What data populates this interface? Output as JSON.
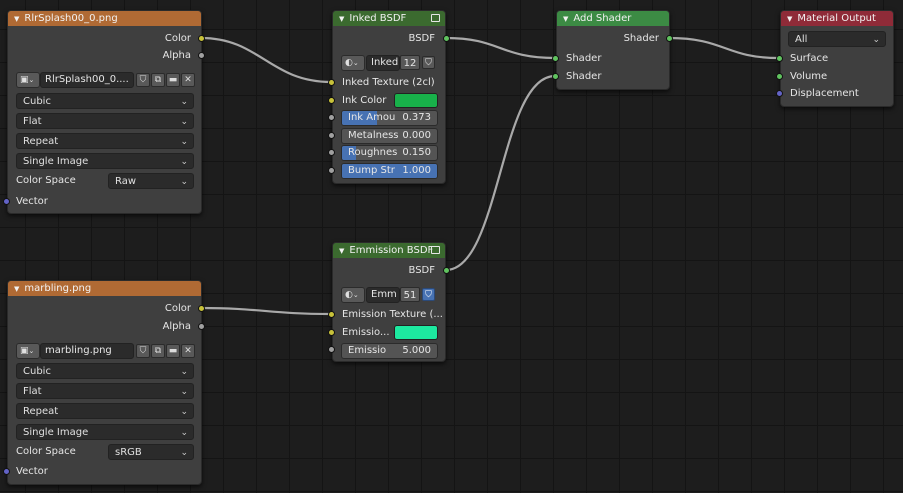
{
  "nodes": {
    "image1": {
      "title": "RlrSplash00_0.png",
      "outputs": [
        "Color",
        "Alpha"
      ],
      "image_name": "RlrSplash00_0....",
      "interpolation": "Cubic",
      "projection": "Flat",
      "extension": "Repeat",
      "source": "Single Image",
      "color_space_label": "Color Space",
      "color_space": "Raw",
      "input": "Vector"
    },
    "image2": {
      "title": "marbling.png",
      "outputs": [
        "Color",
        "Alpha"
      ],
      "image_name": "marbling.png",
      "interpolation": "Cubic",
      "projection": "Flat",
      "extension": "Repeat",
      "source": "Single Image",
      "color_space_label": "Color Space",
      "color_space": "sRGB",
      "input": "Vector"
    },
    "inked": {
      "title": "Inked BSDF",
      "output": "BSDF",
      "group_name": "Inked",
      "users": "12",
      "inputs": {
        "texture": "Inked Texture (2cl)",
        "color_label": "Ink Color",
        "color": "#18b14a",
        "ink_amount_label": "Ink Amou",
        "ink_amount": "0.373",
        "metalness_label": "Metalness",
        "metalness": "0.000",
        "roughness_label": "Roughnes",
        "roughness": "0.150",
        "bump_label": "Bump Str",
        "bump": "1.000"
      }
    },
    "emission": {
      "title": "Emmission BSDF",
      "output": "BSDF",
      "group_name": "Emm",
      "users": "51",
      "inputs": {
        "texture": "Emission Texture (...",
        "color_label": "Emissio...",
        "color": "#1de9a0",
        "strength_label": "Emissio",
        "strength": "5.000"
      }
    },
    "add_shader": {
      "title": "Add Shader",
      "output": "Shader",
      "inputs": [
        "Shader",
        "Shader"
      ]
    },
    "output": {
      "title": "Material Output",
      "target": "All",
      "inputs": [
        "Surface",
        "Volume",
        "Displacement"
      ]
    }
  },
  "colors": {
    "image_header": "#b06a34",
    "shader_header": "#3b6a2f",
    "add_header": "#3c8b44",
    "output_header": "#8f2b38",
    "slider_fill": "#4772b3"
  },
  "icons": {
    "collapse": "triangle-down-icon",
    "image_type": "image-icon",
    "sphere": "material-sphere-icon",
    "shield": "fake-user-shield-icon",
    "copy": "duplicate-icon",
    "folder": "folder-icon",
    "close": "close-icon",
    "group": "node-group-icon"
  }
}
